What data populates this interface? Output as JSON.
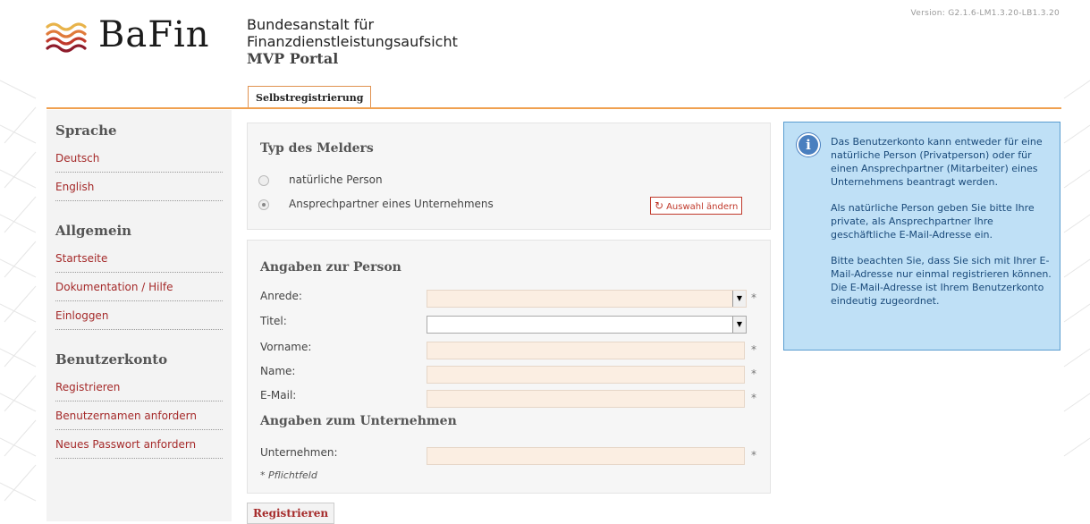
{
  "version": "Version: G2.1.6-LM1.3.20-LB1.3.20",
  "logo": {
    "text": "BaFin"
  },
  "org": {
    "line1": "Bundesanstalt für",
    "line2": "Finanzdienstleistungsaufsicht",
    "portal": "MVP Portal"
  },
  "tabs": [
    {
      "label": "Selbstregistrierung",
      "active": true
    }
  ],
  "sidebar": {
    "groups": [
      {
        "heading": "Sprache",
        "items": [
          "Deutsch",
          "English"
        ]
      },
      {
        "heading": "Allgemein",
        "items": [
          "Startseite",
          "Dokumentation / Hilfe",
          "Einloggen"
        ]
      },
      {
        "heading": "Benutzerkonto",
        "items": [
          "Registrieren",
          "Benutzernamen anfordern",
          "Neues Passwort anfordern"
        ]
      }
    ]
  },
  "melder": {
    "heading": "Typ des Melders",
    "options": [
      {
        "label": "natürliche Person",
        "checked": false
      },
      {
        "label": "Ansprechpartner eines Unternehmens",
        "checked": true
      }
    ],
    "change_button": "Auswahl ändern",
    "change_icon": "refresh-icon"
  },
  "person": {
    "heading": "Angaben zur Person",
    "fields": {
      "anrede": {
        "label": "Anrede:",
        "value": "",
        "required": "*"
      },
      "titel": {
        "label": "Titel:",
        "value": "",
        "required": ""
      },
      "vorname": {
        "label": "Vorname:",
        "value": "",
        "required": "*"
      },
      "name": {
        "label": "Name:",
        "value": "",
        "required": "*"
      },
      "email": {
        "label": "E-Mail:",
        "value": "",
        "required": "*"
      }
    }
  },
  "company": {
    "heading": "Angaben zum Unternehmen",
    "fields": {
      "unternehmen": {
        "label": "Unternehmen:",
        "value": "",
        "required": "*"
      }
    }
  },
  "pflichtfeld_note": "* Pflichtfeld",
  "register_button": "Registrieren",
  "info": {
    "icon": "info-icon",
    "paragraphs": [
      "Das Benutzerkonto kann entweder für eine natürliche Person (Privatperson) oder für einen Ansprechpartner (Mitarbeiter) eines Unternehmens beantragt werden.",
      "Als natürliche Person geben Sie bitte Ihre private, als Ansprechpartner Ihre geschäftliche E-Mail-Adresse ein.",
      "Bitte beachten Sie, dass Sie sich mit Ihrer E-Mail-Adresse nur einmal registrieren können. Die E-Mail-Adresse ist Ihrem Benutzerkonto eindeutig zugeordnet."
    ]
  },
  "colors": {
    "accent": "#f0a050",
    "link": "#a52a2a",
    "required_field_bg": "#fbeee2",
    "info_bg": "#bfe0f6"
  }
}
